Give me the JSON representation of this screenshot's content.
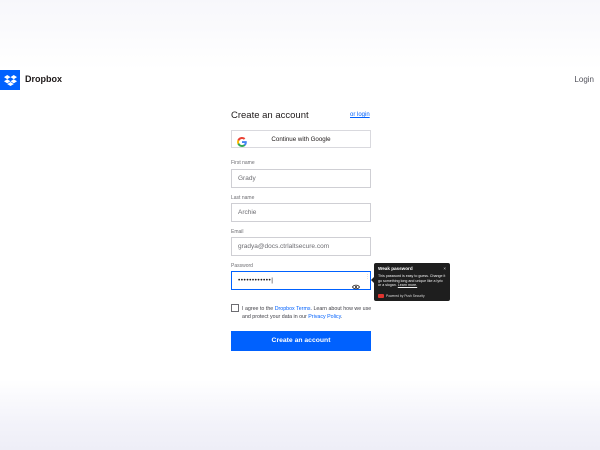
{
  "header": {
    "brand": "Dropbox",
    "login_label": "Login"
  },
  "form": {
    "title": "Create an account",
    "or_login": "or login",
    "google_label": "Continue with Google",
    "first_name": {
      "label": "First name",
      "value": "Grady"
    },
    "last_name": {
      "label": "Last name",
      "value": "Archie"
    },
    "email": {
      "label": "Email",
      "value": "gradya@docs.ctrlaltsecure.com"
    },
    "password": {
      "label": "Password",
      "value": "••••••••••••|"
    },
    "terms": {
      "prefix": "I agree to the ",
      "terms_link": "Dropbox Terms",
      "middle": ". Learn about how we use and protect your data in our ",
      "privacy_link": "Privacy Policy",
      "suffix": "."
    },
    "submit_label": "Create an account"
  },
  "tooltip": {
    "title": "Weak password",
    "close": "×",
    "body": "This password is easy to guess. Change it go something long and unique like a lyric or a slogan. ",
    "learn_more": "Learn more.",
    "footer": "Powered by Push Security"
  },
  "colors": {
    "accent": "#0061fe",
    "tooltip_bg": "#1e1e1e",
    "badge": "#e0342f"
  },
  "icons": {
    "logo": "dropbox-logo-icon",
    "google": "google-g-icon",
    "eye": "eye-icon",
    "more": "kebab-menu-icon"
  }
}
